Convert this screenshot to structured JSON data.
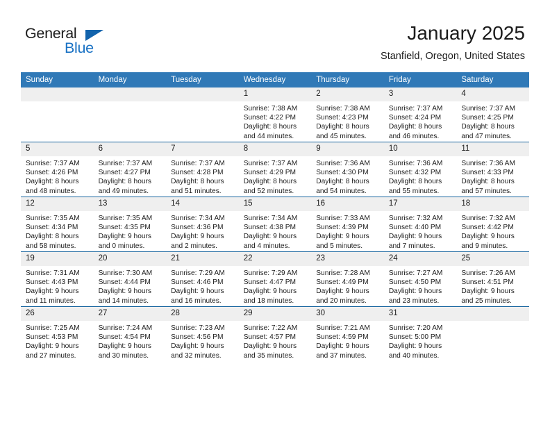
{
  "brand": {
    "name_part1": "General",
    "name_part2": "Blue",
    "accent_color": "#1a72c4",
    "triangle_color": "#1263ac"
  },
  "header": {
    "title": "January 2025",
    "subtitle": "Stanfield, Oregon, United States"
  },
  "calendar": {
    "header_bg": "#3079b7",
    "daynum_bg": "#efefef",
    "row_separator_color": "#15639e",
    "weekdays": [
      "Sunday",
      "Monday",
      "Tuesday",
      "Wednesday",
      "Thursday",
      "Friday",
      "Saturday"
    ],
    "weeks": [
      [
        {
          "day": "",
          "empty": true,
          "sunrise": "",
          "sunset": "",
          "daylight1": "",
          "daylight2": ""
        },
        {
          "day": "",
          "empty": true,
          "sunrise": "",
          "sunset": "",
          "daylight1": "",
          "daylight2": ""
        },
        {
          "day": "",
          "empty": true,
          "sunrise": "",
          "sunset": "",
          "daylight1": "",
          "daylight2": ""
        },
        {
          "day": "1",
          "sunrise": "Sunrise: 7:38 AM",
          "sunset": "Sunset: 4:22 PM",
          "daylight1": "Daylight: 8 hours",
          "daylight2": "and 44 minutes."
        },
        {
          "day": "2",
          "sunrise": "Sunrise: 7:38 AM",
          "sunset": "Sunset: 4:23 PM",
          "daylight1": "Daylight: 8 hours",
          "daylight2": "and 45 minutes."
        },
        {
          "day": "3",
          "sunrise": "Sunrise: 7:37 AM",
          "sunset": "Sunset: 4:24 PM",
          "daylight1": "Daylight: 8 hours",
          "daylight2": "and 46 minutes."
        },
        {
          "day": "4",
          "sunrise": "Sunrise: 7:37 AM",
          "sunset": "Sunset: 4:25 PM",
          "daylight1": "Daylight: 8 hours",
          "daylight2": "and 47 minutes."
        }
      ],
      [
        {
          "day": "5",
          "sunrise": "Sunrise: 7:37 AM",
          "sunset": "Sunset: 4:26 PM",
          "daylight1": "Daylight: 8 hours",
          "daylight2": "and 48 minutes."
        },
        {
          "day": "6",
          "sunrise": "Sunrise: 7:37 AM",
          "sunset": "Sunset: 4:27 PM",
          "daylight1": "Daylight: 8 hours",
          "daylight2": "and 49 minutes."
        },
        {
          "day": "7",
          "sunrise": "Sunrise: 7:37 AM",
          "sunset": "Sunset: 4:28 PM",
          "daylight1": "Daylight: 8 hours",
          "daylight2": "and 51 minutes."
        },
        {
          "day": "8",
          "sunrise": "Sunrise: 7:37 AM",
          "sunset": "Sunset: 4:29 PM",
          "daylight1": "Daylight: 8 hours",
          "daylight2": "and 52 minutes."
        },
        {
          "day": "9",
          "sunrise": "Sunrise: 7:36 AM",
          "sunset": "Sunset: 4:30 PM",
          "daylight1": "Daylight: 8 hours",
          "daylight2": "and 54 minutes."
        },
        {
          "day": "10",
          "sunrise": "Sunrise: 7:36 AM",
          "sunset": "Sunset: 4:32 PM",
          "daylight1": "Daylight: 8 hours",
          "daylight2": "and 55 minutes."
        },
        {
          "day": "11",
          "sunrise": "Sunrise: 7:36 AM",
          "sunset": "Sunset: 4:33 PM",
          "daylight1": "Daylight: 8 hours",
          "daylight2": "and 57 minutes."
        }
      ],
      [
        {
          "day": "12",
          "sunrise": "Sunrise: 7:35 AM",
          "sunset": "Sunset: 4:34 PM",
          "daylight1": "Daylight: 8 hours",
          "daylight2": "and 58 minutes."
        },
        {
          "day": "13",
          "sunrise": "Sunrise: 7:35 AM",
          "sunset": "Sunset: 4:35 PM",
          "daylight1": "Daylight: 9 hours",
          "daylight2": "and 0 minutes."
        },
        {
          "day": "14",
          "sunrise": "Sunrise: 7:34 AM",
          "sunset": "Sunset: 4:36 PM",
          "daylight1": "Daylight: 9 hours",
          "daylight2": "and 2 minutes."
        },
        {
          "day": "15",
          "sunrise": "Sunrise: 7:34 AM",
          "sunset": "Sunset: 4:38 PM",
          "daylight1": "Daylight: 9 hours",
          "daylight2": "and 4 minutes."
        },
        {
          "day": "16",
          "sunrise": "Sunrise: 7:33 AM",
          "sunset": "Sunset: 4:39 PM",
          "daylight1": "Daylight: 9 hours",
          "daylight2": "and 5 minutes."
        },
        {
          "day": "17",
          "sunrise": "Sunrise: 7:32 AM",
          "sunset": "Sunset: 4:40 PM",
          "daylight1": "Daylight: 9 hours",
          "daylight2": "and 7 minutes."
        },
        {
          "day": "18",
          "sunrise": "Sunrise: 7:32 AM",
          "sunset": "Sunset: 4:42 PM",
          "daylight1": "Daylight: 9 hours",
          "daylight2": "and 9 minutes."
        }
      ],
      [
        {
          "day": "19",
          "sunrise": "Sunrise: 7:31 AM",
          "sunset": "Sunset: 4:43 PM",
          "daylight1": "Daylight: 9 hours",
          "daylight2": "and 11 minutes."
        },
        {
          "day": "20",
          "sunrise": "Sunrise: 7:30 AM",
          "sunset": "Sunset: 4:44 PM",
          "daylight1": "Daylight: 9 hours",
          "daylight2": "and 14 minutes."
        },
        {
          "day": "21",
          "sunrise": "Sunrise: 7:29 AM",
          "sunset": "Sunset: 4:46 PM",
          "daylight1": "Daylight: 9 hours",
          "daylight2": "and 16 minutes."
        },
        {
          "day": "22",
          "sunrise": "Sunrise: 7:29 AM",
          "sunset": "Sunset: 4:47 PM",
          "daylight1": "Daylight: 9 hours",
          "daylight2": "and 18 minutes."
        },
        {
          "day": "23",
          "sunrise": "Sunrise: 7:28 AM",
          "sunset": "Sunset: 4:49 PM",
          "daylight1": "Daylight: 9 hours",
          "daylight2": "and 20 minutes."
        },
        {
          "day": "24",
          "sunrise": "Sunrise: 7:27 AM",
          "sunset": "Sunset: 4:50 PM",
          "daylight1": "Daylight: 9 hours",
          "daylight2": "and 23 minutes."
        },
        {
          "day": "25",
          "sunrise": "Sunrise: 7:26 AM",
          "sunset": "Sunset: 4:51 PM",
          "daylight1": "Daylight: 9 hours",
          "daylight2": "and 25 minutes."
        }
      ],
      [
        {
          "day": "26",
          "sunrise": "Sunrise: 7:25 AM",
          "sunset": "Sunset: 4:53 PM",
          "daylight1": "Daylight: 9 hours",
          "daylight2": "and 27 minutes."
        },
        {
          "day": "27",
          "sunrise": "Sunrise: 7:24 AM",
          "sunset": "Sunset: 4:54 PM",
          "daylight1": "Daylight: 9 hours",
          "daylight2": "and 30 minutes."
        },
        {
          "day": "28",
          "sunrise": "Sunrise: 7:23 AM",
          "sunset": "Sunset: 4:56 PM",
          "daylight1": "Daylight: 9 hours",
          "daylight2": "and 32 minutes."
        },
        {
          "day": "29",
          "sunrise": "Sunrise: 7:22 AM",
          "sunset": "Sunset: 4:57 PM",
          "daylight1": "Daylight: 9 hours",
          "daylight2": "and 35 minutes."
        },
        {
          "day": "30",
          "sunrise": "Sunrise: 7:21 AM",
          "sunset": "Sunset: 4:59 PM",
          "daylight1": "Daylight: 9 hours",
          "daylight2": "and 37 minutes."
        },
        {
          "day": "31",
          "sunrise": "Sunrise: 7:20 AM",
          "sunset": "Sunset: 5:00 PM",
          "daylight1": "Daylight: 9 hours",
          "daylight2": "and 40 minutes."
        },
        {
          "day": "",
          "empty": true,
          "sunrise": "",
          "sunset": "",
          "daylight1": "",
          "daylight2": ""
        }
      ]
    ]
  }
}
